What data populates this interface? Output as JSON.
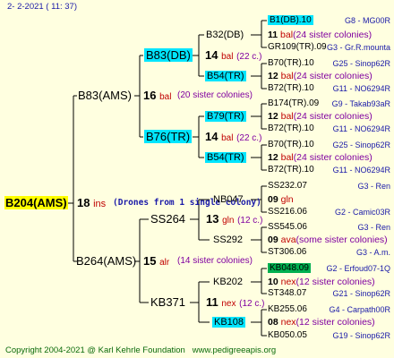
{
  "header": {
    "date": "2-  2-2021 ( 11: 37)"
  },
  "footer": {
    "copyright": "Copyright 2004-2021 @ Karl Kehrle Foundation",
    "site": "www.pedigreeapis.org"
  },
  "root": {
    "name": "B204(AMS)",
    "gen": "18",
    "breed": "ins",
    "note": "(Drones from 1 single colony)"
  },
  "g1": [
    {
      "name": "B83(AMS)",
      "gen": "16",
      "breed": "bal",
      "note": "(20 sister colonies)"
    },
    {
      "name": "B264(AMS)",
      "gen": "15",
      "breed": "alr",
      "note": "(14 sister colonies)"
    }
  ],
  "g2": [
    {
      "name": "B83(DB)",
      "gen": "14",
      "breed": "bal",
      "note": "(22 c.)"
    },
    {
      "name": "B76(TR)",
      "gen": "14",
      "breed": "bal",
      "note": "(22 c.)"
    },
    {
      "name": "SS264",
      "gen": "13",
      "breed": "gln",
      "note": "(12 c.)"
    },
    {
      "name": "KB371",
      "gen": "11",
      "breed": "nex",
      "note": "(12 c.)"
    }
  ],
  "g3": [
    {
      "name": "B32(DB)",
      "gen": "11",
      "breed": "bal",
      "note": "(24 sister colonies)"
    },
    {
      "name": "B54(TR)",
      "gen": "12",
      "breed": "bal",
      "note": "(24 sister colonies)"
    },
    {
      "name": "B79(TR)",
      "gen": "12",
      "breed": "bal",
      "note": "(24 sister colonies)"
    },
    {
      "name": "B54(TR)",
      "gen": "12",
      "breed": "bal",
      "note": "(24 sister colonies)"
    },
    {
      "name": "NB047",
      "gen": "09",
      "breed": "gln",
      "note": ""
    },
    {
      "name": "SS292",
      "gen": "09",
      "breed": "ava",
      "note": "(some sister colonies)"
    },
    {
      "name": "KB202",
      "gen": "10",
      "breed": "nex",
      "note": "(12 sister colonies)"
    },
    {
      "name": "KB108",
      "gen": "08",
      "breed": "nex",
      "note": "(12 sister colonies)"
    }
  ],
  "g4": [
    {
      "name": "B1(DB).10",
      "right": "G8 - MG00R"
    },
    {
      "name": "GR109(TR).09",
      "right": "G3 - Gr.R.mounta"
    },
    {
      "name": "B70(TR).10",
      "right": "G25 - Sinop62R"
    },
    {
      "name": "B72(TR).10",
      "right": "G11 - NO6294R"
    },
    {
      "name": "B174(TR).09",
      "right": "G9 - Takab93aR"
    },
    {
      "name": "B72(TR).10",
      "right": "G11 - NO6294R"
    },
    {
      "name": "B70(TR).10",
      "right": "G25 - Sinop62R"
    },
    {
      "name": "B72(TR).10",
      "right": "G11 - NO6294R"
    },
    {
      "name": "SS232.07",
      "right": "G3 - Ren"
    },
    {
      "name": "SS216.06",
      "right": "G2 - Camic03R"
    },
    {
      "name": "SS545.06",
      "right": "G3 - Ren"
    },
    {
      "name": "ST306.06",
      "right": "G3 - A.m."
    },
    {
      "name": "KB048.09",
      "right": "G2 - Erfoud07-1Q"
    },
    {
      "name": "ST348.07",
      "right": "G21 - Sinop62R"
    },
    {
      "name": "KB255.06",
      "right": "G4 - Carpath00R"
    },
    {
      "name": "KB050.05",
      "right": "G19 - Sinop62R"
    }
  ]
}
